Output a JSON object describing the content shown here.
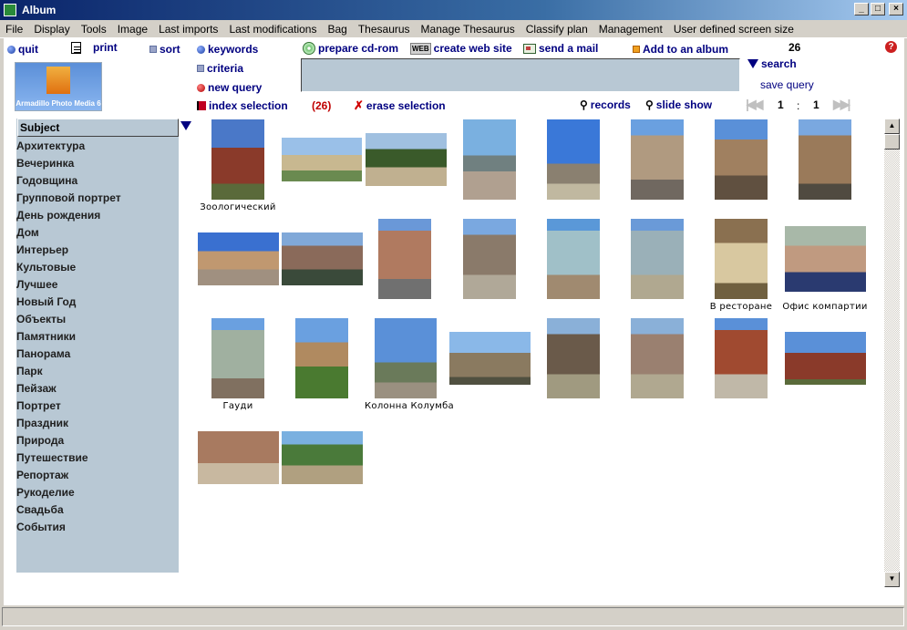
{
  "window": {
    "title": "Album"
  },
  "menu": [
    "File",
    "Display",
    "Tools",
    "Image",
    "Last imports",
    "Last modifications",
    "Bag",
    "Thesaurus",
    "Manage Thesaurus",
    "Classify plan",
    "Management",
    "User defined screen size"
  ],
  "toolbar": {
    "quit": "quit",
    "print": "print",
    "sort": "sort",
    "keywords": "keywords",
    "criteria": "criteria",
    "new_query": "new query",
    "index_selection": "index selection",
    "prepare_cd": "prepare cd-rom",
    "create_web": "create web site",
    "send_mail": "send a mail",
    "add_album": "Add to an album",
    "search": "search",
    "save_query": "save query",
    "selection_count": "(26)",
    "erase_selection": "erase selection",
    "records": "records",
    "slide_show": "slide show",
    "total_count": "26",
    "page_current": "1",
    "page_sep": ":",
    "page_total": "1",
    "help": "?"
  },
  "logo": {
    "text": "Armadillo Photo Media 6"
  },
  "search": {
    "value": ""
  },
  "subject": {
    "header": "Subject",
    "items": [
      "Архитектура",
      "Вечеринка",
      "Годовщина",
      "Групповой портрет",
      "День рождения",
      "Дом",
      "Интерьер",
      "Культовые",
      "Лучшее",
      "Новый Год",
      "Объекты",
      "Памятники",
      "Панорама",
      "Парк",
      "Пейзаж",
      "Портрет",
      "Праздник",
      "Природа",
      "Путешествие",
      "Репортаж",
      "Рукоделие",
      "Свадьба",
      "События"
    ]
  },
  "thumbnails": {
    "captions": [
      "Зоологический",
      "В ресторане",
      "Офис компартии",
      "Гауди",
      "Колонна Колумба"
    ]
  },
  "colors": {
    "accent": "#000080",
    "list_bg": "#b8c8d4",
    "selection_red": "#c00000"
  }
}
